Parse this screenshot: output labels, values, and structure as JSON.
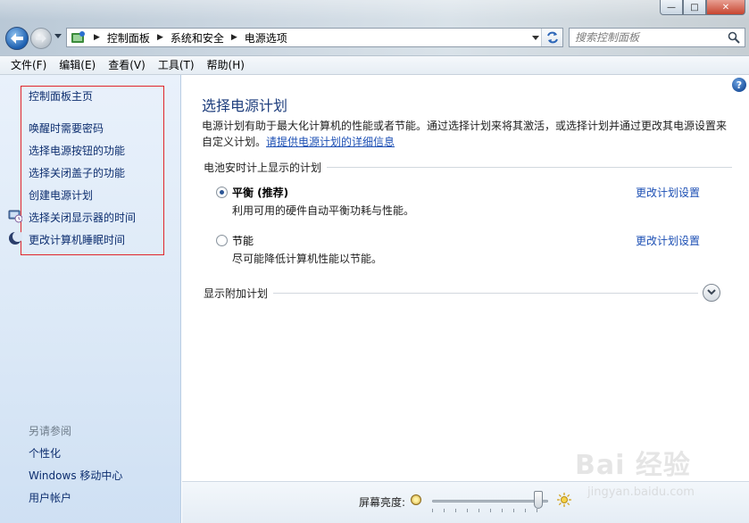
{
  "window": {
    "controls": {
      "minimize": "—",
      "maximize": "□",
      "close": "✕"
    }
  },
  "address_bar": {
    "crumbs": [
      "控制面板",
      "系统和安全",
      "电源选项"
    ],
    "separator": "▶"
  },
  "search": {
    "placeholder": "搜索控制面板"
  },
  "menu": {
    "items": [
      "文件(F)",
      "编辑(E)",
      "查看(V)",
      "工具(T)",
      "帮助(H)"
    ]
  },
  "sidebar": {
    "home": "控制面板主页",
    "links": [
      "唤醒时需要密码",
      "选择电源按钮的功能",
      "选择关闭盖子的功能",
      "创建电源计划",
      "选择关闭显示器的时间",
      "更改计算机睡眠时间"
    ],
    "see_also_label": "另请参阅",
    "see_also": [
      "个性化",
      "Windows 移动中心",
      "用户帐户"
    ]
  },
  "main": {
    "title": "选择电源计划",
    "description": "电源计划有助于最大化计算机的性能或者节能。通过选择计划来将其激活，或选择计划并通过更改其电源设置来自定义计划。",
    "description_link": "请提供电源计划的详细信息",
    "section_battery": "电池安时计上显示的计划",
    "plans": [
      {
        "name": "平衡 (推荐)",
        "desc": "利用可用的硬件自动平衡功耗与性能。",
        "link": "更改计划设置",
        "selected": true
      },
      {
        "name": "节能",
        "desc": "尽可能降低计算机性能以节能。",
        "link": "更改计划设置",
        "selected": false
      }
    ],
    "section_more": "显示附加计划",
    "help": "?"
  },
  "bottom": {
    "brightness_label": "屏幕亮度:",
    "brightness_level": 0.95
  },
  "watermark": {
    "text": "Bai 经验",
    "sub": "jingyan.baidu.com"
  }
}
